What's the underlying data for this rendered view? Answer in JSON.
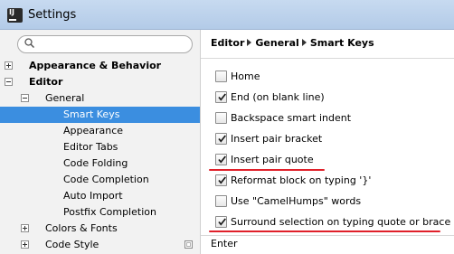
{
  "window": {
    "title": "Settings",
    "icon_name": "intellij-idea-icon"
  },
  "search": {
    "placeholder": ""
  },
  "tree": [
    {
      "label": "Appearance & Behavior",
      "level": 0,
      "toggle": "plus",
      "bold": true
    },
    {
      "label": "Editor",
      "level": 0,
      "toggle": "minus",
      "bold": true
    },
    {
      "label": "General",
      "level": 1,
      "toggle": "minus",
      "bold": false
    },
    {
      "label": "Smart Keys",
      "level": 2,
      "toggle": "none",
      "bold": false,
      "selected": true
    },
    {
      "label": "Appearance",
      "level": 2,
      "toggle": "none",
      "bold": false
    },
    {
      "label": "Editor Tabs",
      "level": 2,
      "toggle": "none",
      "bold": false
    },
    {
      "label": "Code Folding",
      "level": 2,
      "toggle": "none",
      "bold": false
    },
    {
      "label": "Code Completion",
      "level": 2,
      "toggle": "none",
      "bold": false
    },
    {
      "label": "Auto Import",
      "level": 2,
      "toggle": "none",
      "bold": false
    },
    {
      "label": "Postfix Completion",
      "level": 2,
      "toggle": "none",
      "bold": false
    },
    {
      "label": "Colors & Fonts",
      "level": 1,
      "toggle": "plus",
      "bold": false
    },
    {
      "label": "Code Style",
      "level": 1,
      "toggle": "plus",
      "bold": false
    }
  ],
  "breadcrumb": [
    "Editor",
    "General",
    "Smart Keys"
  ],
  "options": [
    {
      "label": "Home",
      "checked": false
    },
    {
      "label": "End (on blank line)",
      "checked": true
    },
    {
      "label": "Backspace smart indent",
      "checked": false
    },
    {
      "label": "Insert pair bracket",
      "checked": true
    },
    {
      "label": "Insert pair quote",
      "checked": true
    },
    {
      "label": "Reformat block on typing '}'",
      "checked": true
    },
    {
      "label": "Use \"CamelHumps\" words",
      "checked": false
    },
    {
      "label": "Surround selection on typing quote or brace",
      "checked": true
    }
  ],
  "section": {
    "enter_label": "Enter"
  },
  "colors": {
    "selection": "#3b8ee0",
    "annotation": "#e0202a"
  }
}
